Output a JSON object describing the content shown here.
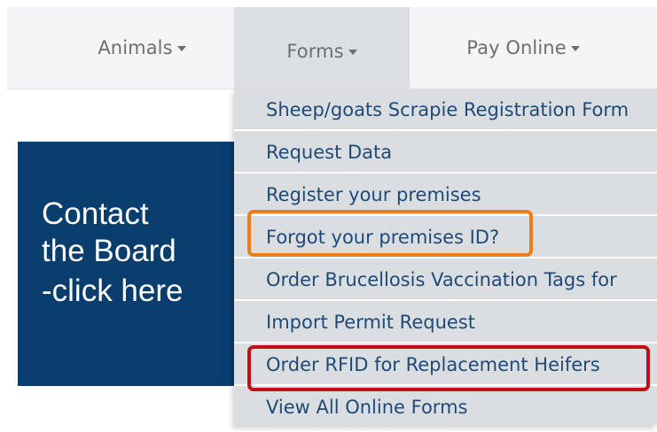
{
  "navbar": {
    "items": [
      {
        "label": "Animals",
        "icon": "caret-down-icon"
      },
      {
        "label": "Forms",
        "icon": "caret-down-icon",
        "active": true
      },
      {
        "label": "Pay Online",
        "icon": "caret-down-icon"
      }
    ]
  },
  "contact": {
    "line1": "Contact",
    "line2": "the Board",
    "line3": "-click here"
  },
  "forms_menu": {
    "items": [
      {
        "label": "Sheep/goats Scrapie Registration Form"
      },
      {
        "label": "Request Data"
      },
      {
        "label": "Register your premises"
      },
      {
        "label": "Forgot your premises ID?"
      },
      {
        "label": "Order Brucellosis Vaccination Tags for"
      },
      {
        "label": "Import Permit Request"
      },
      {
        "label": "Order RFID for Replacement Heifers"
      },
      {
        "label": "View All Online Forms"
      }
    ]
  },
  "colors": {
    "nav_bg": "#f4f5f6",
    "nav_active_bg": "#dde0e3",
    "contact_bg": "#083d6e",
    "menu_text": "#1f4a78",
    "highlight_orange": "#ee7d1a",
    "highlight_red": "#c00d17"
  }
}
